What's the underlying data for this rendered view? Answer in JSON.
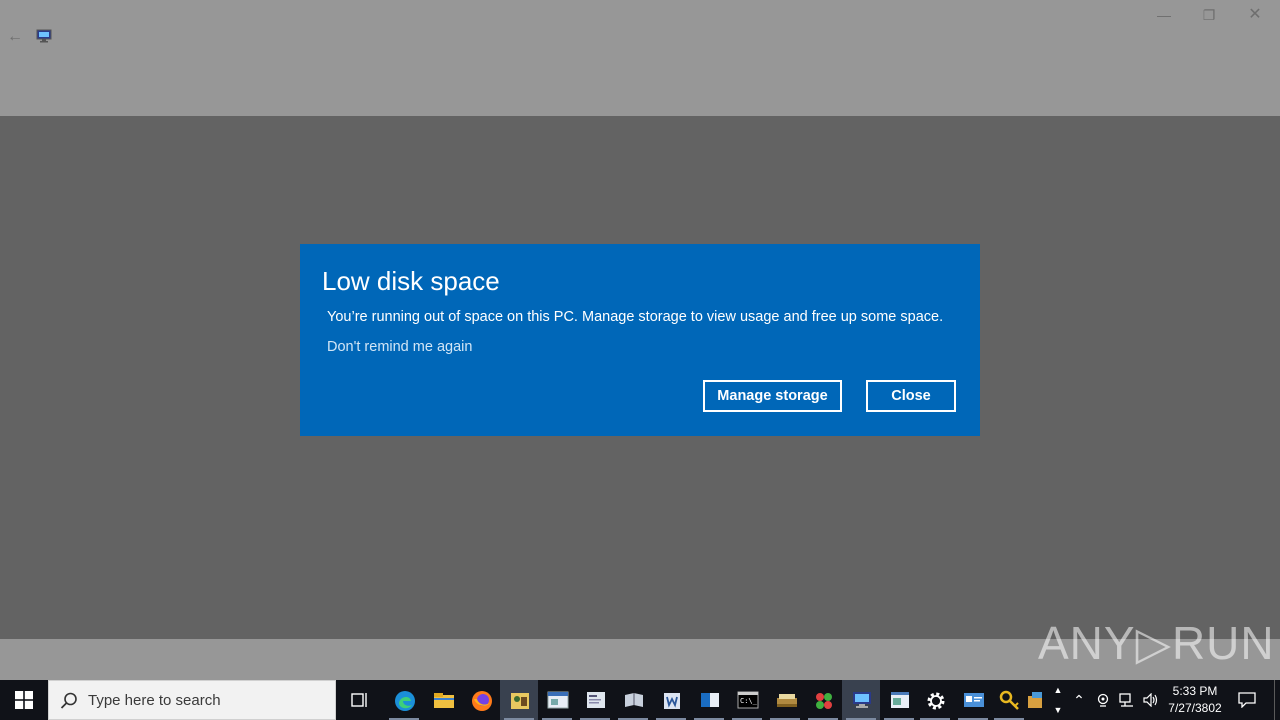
{
  "window": {
    "back_icon": "back-arrow-icon",
    "app_icon": "monitor-icon",
    "minimize_glyph": "—",
    "maximize_glyph": "❐",
    "close_glyph": "✕"
  },
  "dialog": {
    "title": "Low disk space",
    "message": "You’re running out of space on this PC. Manage storage to view usage and free up some space.",
    "dont_remind": "Don't remind me again",
    "manage_storage_label": "Manage storage",
    "close_label": "Close",
    "accent_color": "#0067b8"
  },
  "watermark": {
    "text": "ANY▷RUN"
  },
  "taskbar": {
    "search_placeholder": "Type here to search",
    "apps": [
      "task-view-icon",
      "edge-icon",
      "file-explorer-icon",
      "firefox-icon",
      "sticky-app-icon",
      "window-app-icon",
      "document-app-icon",
      "book-app-icon",
      "word-app-icon",
      "outlook-app-icon",
      "terminal-icon",
      "scanner-app-icon",
      "puzzle-app-icon",
      "monitor-app-icon",
      "notepad-app-icon",
      "settings-gear-icon",
      "contact-card-icon",
      "key-icon",
      "package-app-icon"
    ],
    "clock_time": "5:33 PM",
    "clock_date": "7/27/3802"
  }
}
